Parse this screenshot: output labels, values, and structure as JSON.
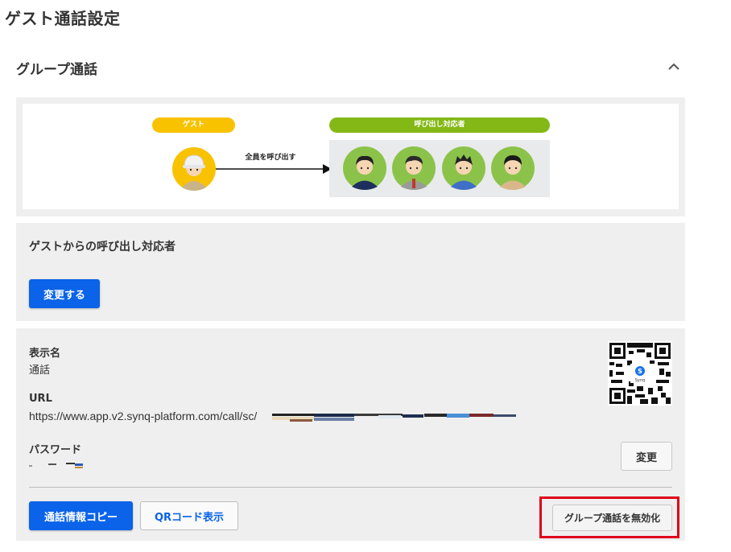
{
  "page": {
    "title": "ゲスト通話設定"
  },
  "section": {
    "title": "グループ通話"
  },
  "illustration": {
    "guest_label": "ゲスト",
    "responders_label": "呼び出し対応者",
    "arrow_label": "全員を呼び出す"
  },
  "callee": {
    "title": "ゲストからの呼び出し対応者",
    "change_button": "変更する"
  },
  "info": {
    "name_label": "表示名",
    "name_value": "通話",
    "url_label": "URL",
    "url_value": "https://www.app.v2.synq-platform.com/call/sc/",
    "password_label": "パスワード",
    "change_password_button": "変更",
    "copy_button": "通話情報コピー",
    "qr_button": "QRコード表示",
    "disable_button": "グループ通話を無効化"
  },
  "colors": {
    "primary": "#0a63e8",
    "guest_pill": "#f9c200",
    "responder_pill": "#84b816",
    "highlight": "#e0001b"
  }
}
